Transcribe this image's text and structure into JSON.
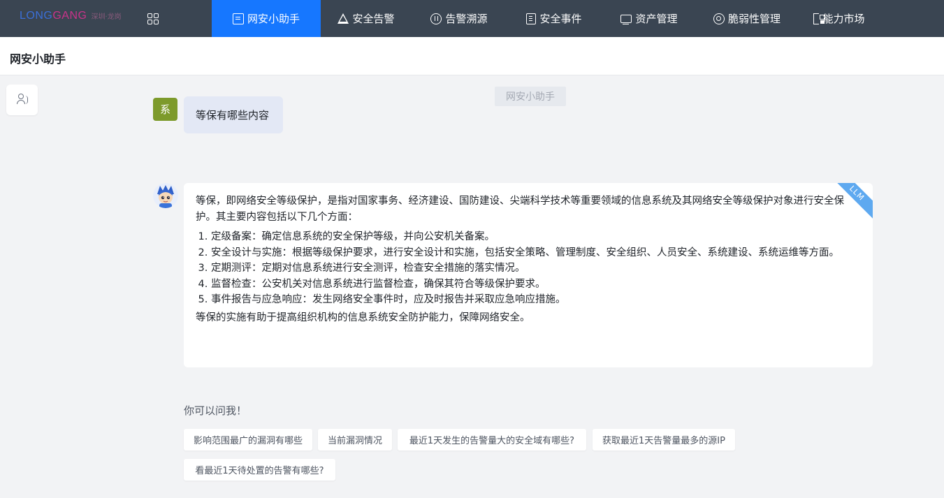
{
  "header": {
    "logo_main_a": "LONG",
    "logo_main_b": "GANG",
    "logo_sub": "深圳·龙岗",
    "nav": [
      {
        "label": "网安小助手",
        "icon": "chat-icon",
        "active": true
      },
      {
        "label": "安全告警",
        "icon": "warning-icon"
      },
      {
        "label": "告警溯源",
        "icon": "trace-icon"
      },
      {
        "label": "安全事件",
        "icon": "document-icon"
      },
      {
        "label": "资产管理",
        "icon": "monitor-icon"
      },
      {
        "label": "脆弱性管理",
        "icon": "target-icon"
      },
      {
        "label": "能力市场",
        "icon": "market-icon"
      }
    ],
    "accent": "#1677ff",
    "bar_color": "#3a4552"
  },
  "page": {
    "title": "网安小助手",
    "watermark": "网安小助手"
  },
  "conversation": {
    "user_avatar_text": "系",
    "user_message": "等保有哪些内容",
    "answer": {
      "badge": "LLM",
      "intro": "等保，即网络安全等级保护，是指对国家事务、经济建设、国防建设、尖端科学技术等重要领域的信息系统及其网络安全等级保护对象进行安全保护。其主要内容包括以下几个方面：",
      "items": [
        "定级备案：确定信息系统的安全保护等级，并向公安机关备案。",
        "安全设计与实施：根据等级保护要求，进行安全设计和实施，包括安全策略、管理制度、安全组织、人员安全、系统建设、系统运维等方面。",
        "定期测评：定期对信息系统进行安全测评，检查安全措施的落实情况。",
        "监督检查：公安机关对信息系统进行监督检查，确保其符合等级保护要求。",
        "事件报告与应急响应：发生网络安全事件时，应及时报告并采取应急响应措施。"
      ],
      "outro": "等保的实施有助于提高组织机构的信息系统安全防护能力，保障网络安全。"
    }
  },
  "suggestions": {
    "title": "你可以问我！",
    "items": [
      "影响范围最广的漏洞有哪些",
      "当前漏洞情况",
      "最近1天发生的告警量大的安全域有哪些?",
      "获取最近1天告警量最多的源IP",
      "看最近1天待处置的告警有哪些?"
    ]
  }
}
